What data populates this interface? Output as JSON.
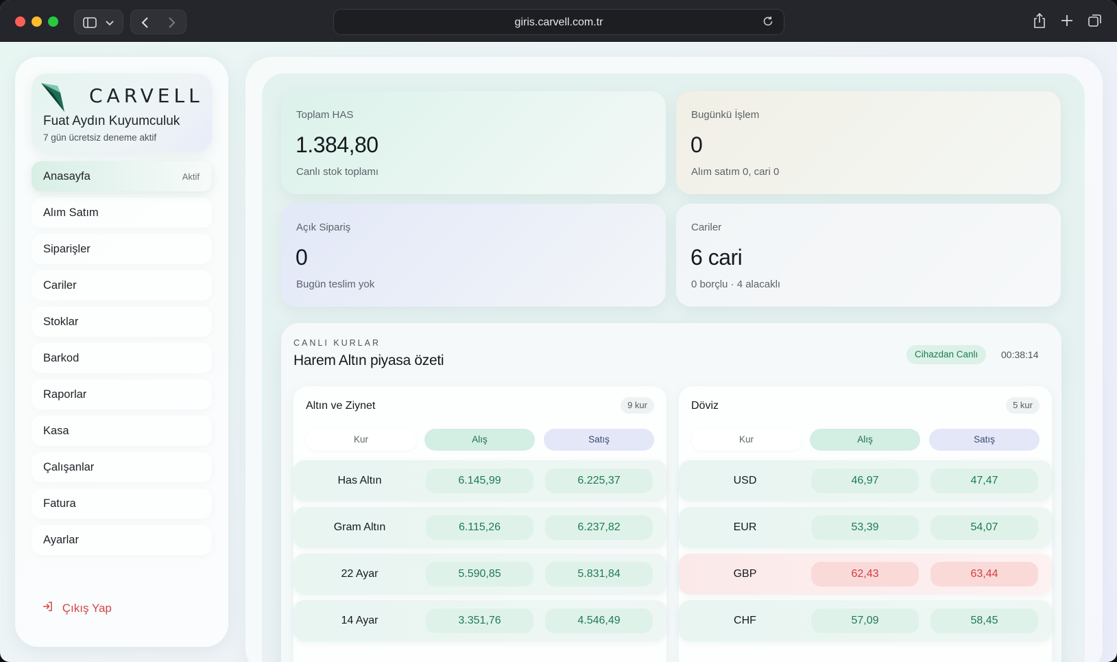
{
  "browser": {
    "url": "giris.carvell.com.tr"
  },
  "sidebar": {
    "logo_text": "CARVELL",
    "company": "Fuat Aydın Kuyumculuk",
    "trial": "7 gün ücretsiz deneme aktif",
    "active_badge": "Aktif",
    "items": [
      {
        "label": "Anasayfa"
      },
      {
        "label": "Alım Satım"
      },
      {
        "label": "Siparişler"
      },
      {
        "label": "Cariler"
      },
      {
        "label": "Stoklar"
      },
      {
        "label": "Barkod"
      },
      {
        "label": "Raporlar"
      },
      {
        "label": "Kasa"
      },
      {
        "label": "Çalışanlar"
      },
      {
        "label": "Fatura"
      },
      {
        "label": "Ayarlar"
      }
    ],
    "logout": "Çıkış Yap"
  },
  "stats": {
    "total_has": {
      "label": "Toplam HAS",
      "value": "1.384,80",
      "sub": "Canlı stok toplamı"
    },
    "today": {
      "label": "Bugünkü İşlem",
      "value": "0",
      "sub": "Alım satım 0, cari 0"
    },
    "orders": {
      "label": "Açık Sipariş",
      "value": "0",
      "sub": "Bugün teslim yok"
    },
    "accounts": {
      "label": "Cariler",
      "value": "6 cari",
      "sub": "0 borçlu · 4 alacaklı"
    }
  },
  "rates": {
    "kicker": "CANLI KURLAR",
    "title": "Harem Altın piyasa özeti",
    "live_label": "Cihazdan Canlı",
    "time": "00:38:14",
    "columns": {
      "kur": "Kur",
      "alis": "Alış",
      "satis": "Satış"
    },
    "gold": {
      "title": "Altın ve Ziynet",
      "count": "9 kur",
      "rows": [
        {
          "name": "Has Altın",
          "alis": "6.145,99",
          "satis": "6.225,37"
        },
        {
          "name": "Gram Altın",
          "alis": "6.115,26",
          "satis": "6.237,82"
        },
        {
          "name": "22 Ayar",
          "alis": "5.590,85",
          "satis": "5.831,84"
        },
        {
          "name": "14 Ayar",
          "alis": "3.351,76",
          "satis": "4.546,49"
        }
      ]
    },
    "fx": {
      "title": "Döviz",
      "count": "5 kur",
      "rows": [
        {
          "name": "USD",
          "alis": "46,97",
          "satis": "47,47"
        },
        {
          "name": "EUR",
          "alis": "53,39",
          "satis": "54,07"
        },
        {
          "name": "GBP",
          "alis": "62,43",
          "satis": "63,44"
        },
        {
          "name": "CHF",
          "alis": "57,09",
          "satis": "58,45"
        }
      ]
    }
  },
  "colors": {
    "accent": "#1e7a58",
    "alert": "#d23d3d",
    "logout": "#d64545"
  }
}
